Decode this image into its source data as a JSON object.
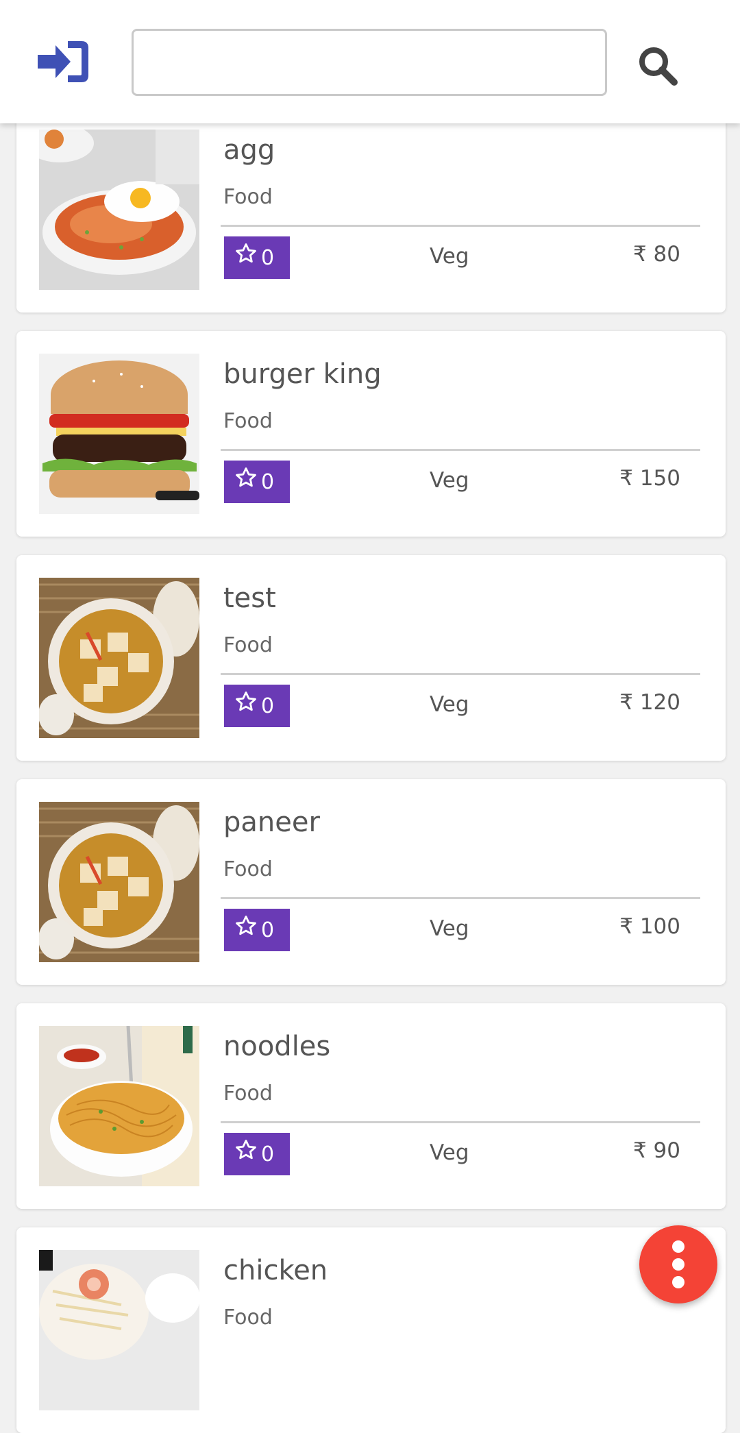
{
  "header": {
    "login_icon": "sign-in-icon",
    "search_placeholder": "",
    "search_value": "",
    "search_icon": "search-icon"
  },
  "items": [
    {
      "name": "agg",
      "category": "Food",
      "rating": "0",
      "type": "Veg",
      "price": "₹ 80",
      "image": "egg-fried-rice"
    },
    {
      "name": "burger king",
      "category": "Food",
      "rating": "0",
      "type": "Veg",
      "price": "₹ 150",
      "image": "burger"
    },
    {
      "name": "test",
      "category": "Food",
      "rating": "0",
      "type": "Veg",
      "price": "₹ 120",
      "image": "paneer-curry"
    },
    {
      "name": "paneer",
      "category": "Food",
      "rating": "0",
      "type": "Veg",
      "price": "₹ 100",
      "image": "paneer-curry"
    },
    {
      "name": "noodles",
      "category": "Food",
      "rating": "0",
      "type": "Veg",
      "price": "₹ 90",
      "image": "noodles"
    },
    {
      "name": "chicken",
      "category": "Food",
      "rating": "",
      "type": "",
      "price": "",
      "image": "chicken-salad"
    }
  ],
  "fab": {
    "icon": "more-vertical-icon"
  },
  "colors": {
    "accent": "#6a3ab5",
    "fab": "#f44336",
    "login_icon": "#3f51b5",
    "search_icon": "#444444"
  }
}
